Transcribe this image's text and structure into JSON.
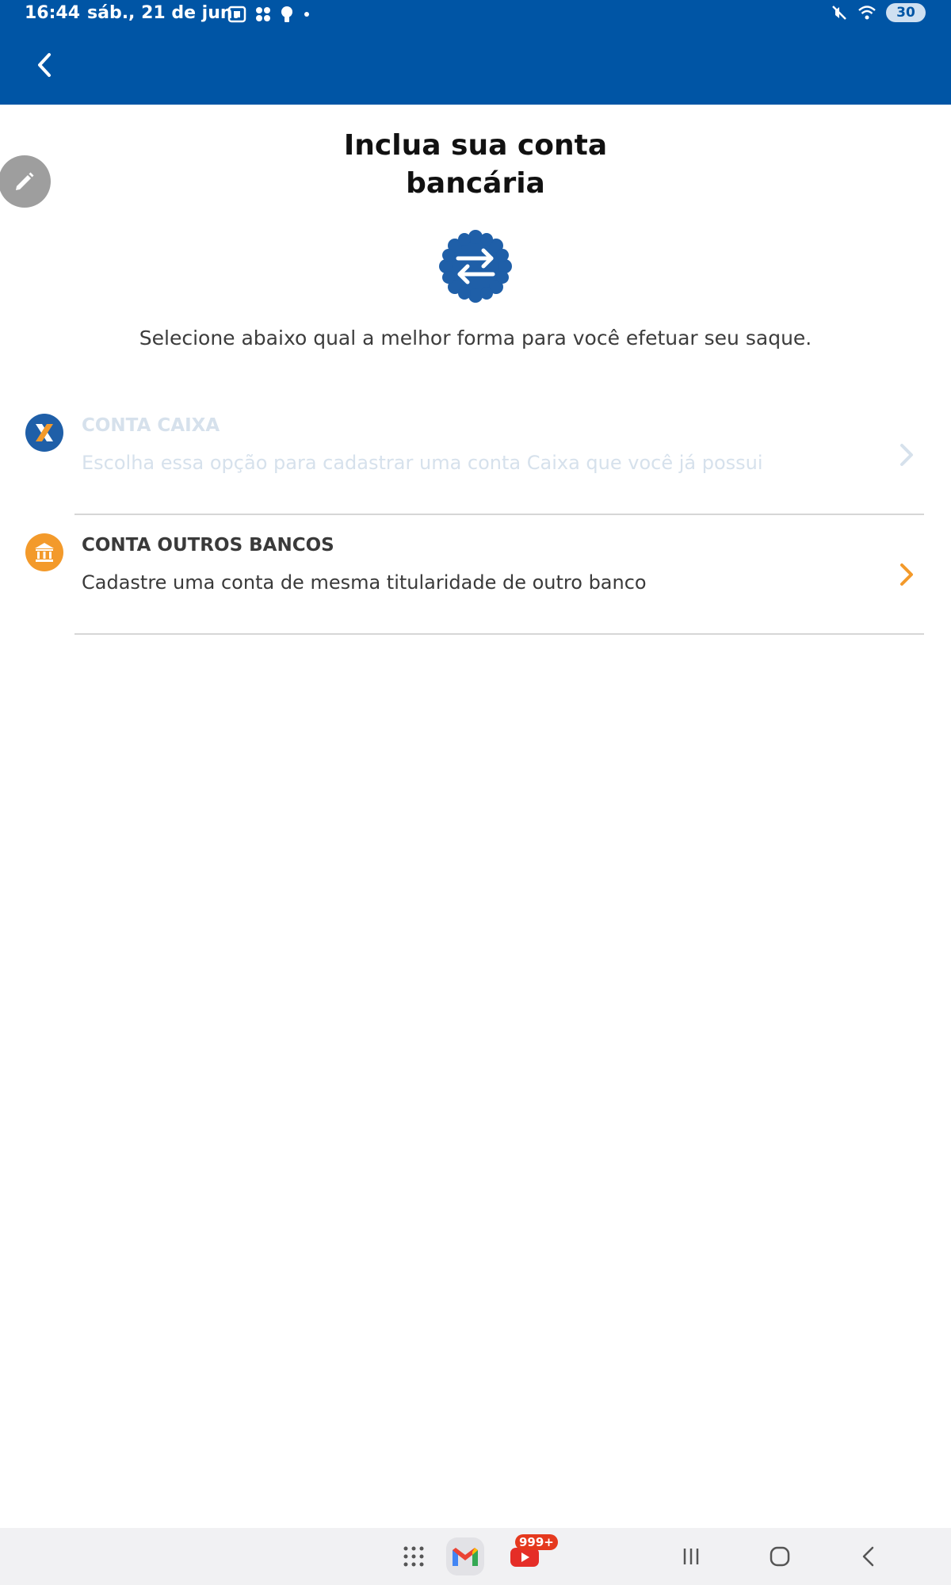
{
  "status_bar": {
    "time": "16:44",
    "date": "sáb., 21 de jun.",
    "battery": "30",
    "icons_left": [
      "screenshot-icon",
      "apps-grid-icon",
      "bulb-icon",
      "dot-icon"
    ],
    "icons_right": [
      "mute-icon",
      "wifi-icon",
      "battery-icon"
    ]
  },
  "header": {
    "background_color": "#0055a5",
    "back_icon": "chevron-left-icon"
  },
  "main": {
    "title_line1": "Inclua sua conta",
    "title_line2": "bancária",
    "subtitle": "Selecione abaixo qual a melhor forma para você efetuar seu saque.",
    "badge_icon": "swap-arrows-icon",
    "options": [
      {
        "title": "CONTA CAIXA",
        "description": "Escolha essa opção para cadastrar uma conta Caixa que você já possui",
        "icon": "caixa-logo-icon",
        "disabled": true
      },
      {
        "title": "CONTA OUTROS BANCOS",
        "description": "Cadastre uma conta de mesma titularidade de outro banco",
        "icon": "bank-icon",
        "disabled": false
      }
    ]
  },
  "floating": {
    "edit_icon": "pencil-icon"
  },
  "nav_bar": {
    "apps_icon": "apps-grid-icon",
    "gmail_icon": "gmail-icon",
    "youtube_icon": "youtube-icon",
    "youtube_badge": "999+",
    "recent_icon": "recent-apps-icon",
    "home_icon": "home-icon",
    "back_icon": "back-icon"
  },
  "colors": {
    "brand_blue": "#0055a5",
    "accent_orange": "#f39a2b",
    "disabled_text": "#d6e1ec"
  }
}
